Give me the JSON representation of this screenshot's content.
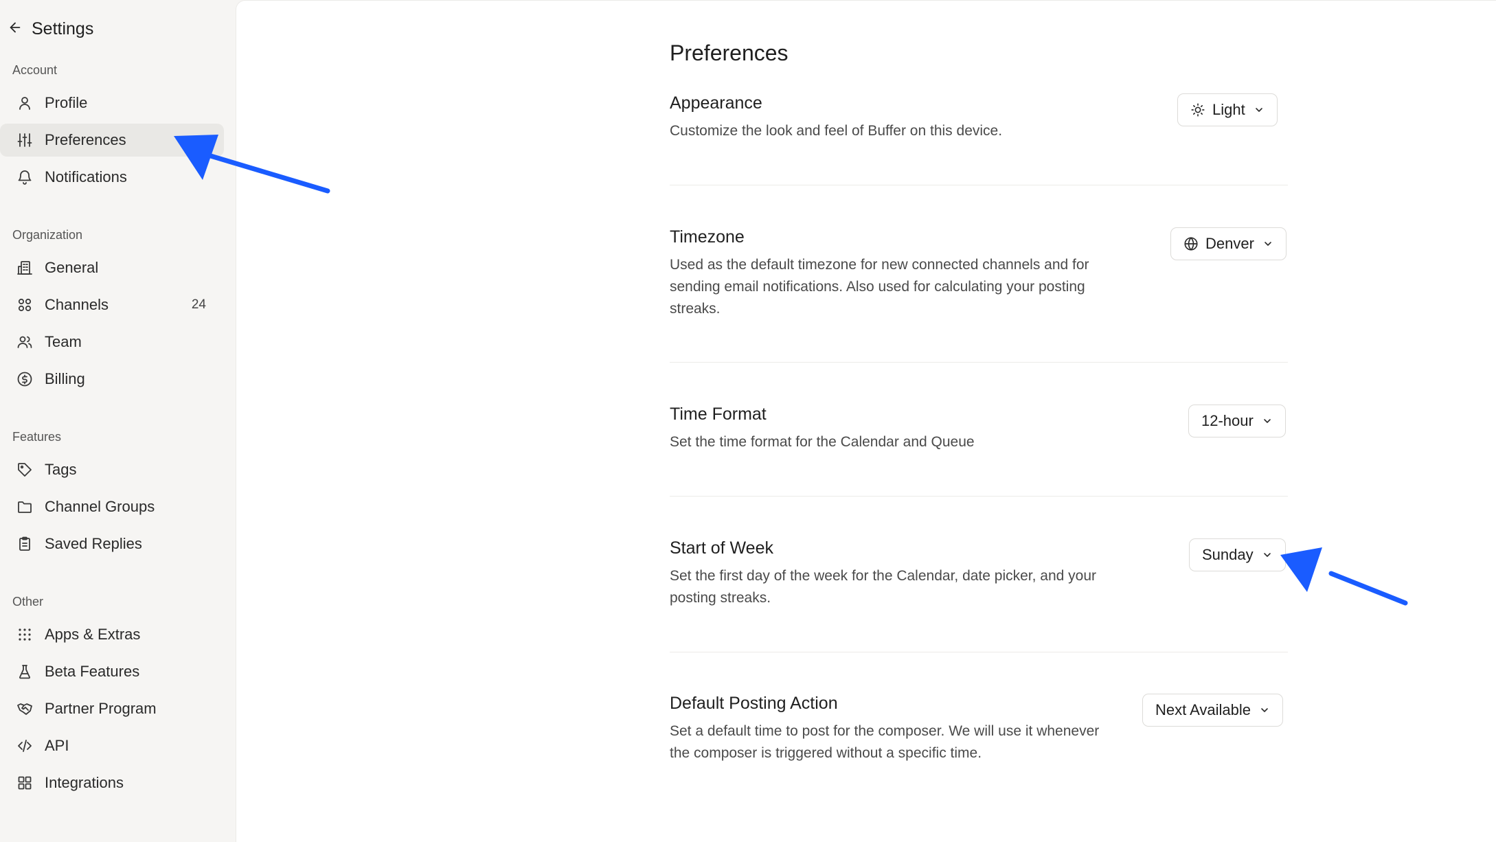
{
  "sidebar": {
    "title": "Settings",
    "sections": {
      "account": "Account",
      "organization": "Organization",
      "features": "Features",
      "other": "Other"
    },
    "items": {
      "profile": "Profile",
      "preferences": "Preferences",
      "notifications": "Notifications",
      "general": "General",
      "channels": "Channels",
      "channels_count": "24",
      "team": "Team",
      "billing": "Billing",
      "tags": "Tags",
      "channel_groups": "Channel Groups",
      "saved_replies": "Saved Replies",
      "apps_extras": "Apps & Extras",
      "beta_features": "Beta Features",
      "partner_program": "Partner Program",
      "api": "API",
      "integrations": "Integrations"
    },
    "active_item": "preferences"
  },
  "main": {
    "title": "Preferences",
    "settings": {
      "appearance": {
        "title": "Appearance",
        "description": "Customize the look and feel of Buffer on this device.",
        "value": "Light"
      },
      "timezone": {
        "title": "Timezone",
        "description": "Used as the default timezone for new connected channels and for sending email notifications. Also used for calculating your posting streaks.",
        "value": "Denver"
      },
      "time_format": {
        "title": "Time Format",
        "description": "Set the time format for the Calendar and Queue",
        "value": "12-hour"
      },
      "start_of_week": {
        "title": "Start of Week",
        "description": "Set the first day of the week for the Calendar, date picker, and your posting streaks.",
        "value": "Sunday"
      },
      "default_posting_action": {
        "title": "Default Posting Action",
        "description": "Set a default time to post for the composer. We will use it whenever the composer is triggered without a specific time.",
        "value": "Next Available"
      }
    }
  },
  "colors": {
    "annotation_arrow": "#1a5cff",
    "sidebar_bg": "#f6f5f3",
    "active_item_bg": "#e9e8e5",
    "main_bg": "#ffffff"
  },
  "icons": {
    "back": "arrow-left-icon",
    "profile": "user-icon",
    "preferences": "sliders-icon",
    "notifications": "bell-icon",
    "general": "building-icon",
    "channels": "grid-circles-icon",
    "team": "users-icon",
    "billing": "dollar-circle-icon",
    "tags": "tag-icon",
    "channel_groups": "folder-icon",
    "saved_replies": "clipboard-icon",
    "apps_extras": "dots-grid-icon",
    "beta_features": "flask-icon",
    "partner_program": "handshake-icon",
    "api": "code-icon",
    "integrations": "apps-grid-icon",
    "appearance": "sun-icon",
    "timezone": "globe-icon",
    "dropdown": "chevron-down-icon"
  }
}
